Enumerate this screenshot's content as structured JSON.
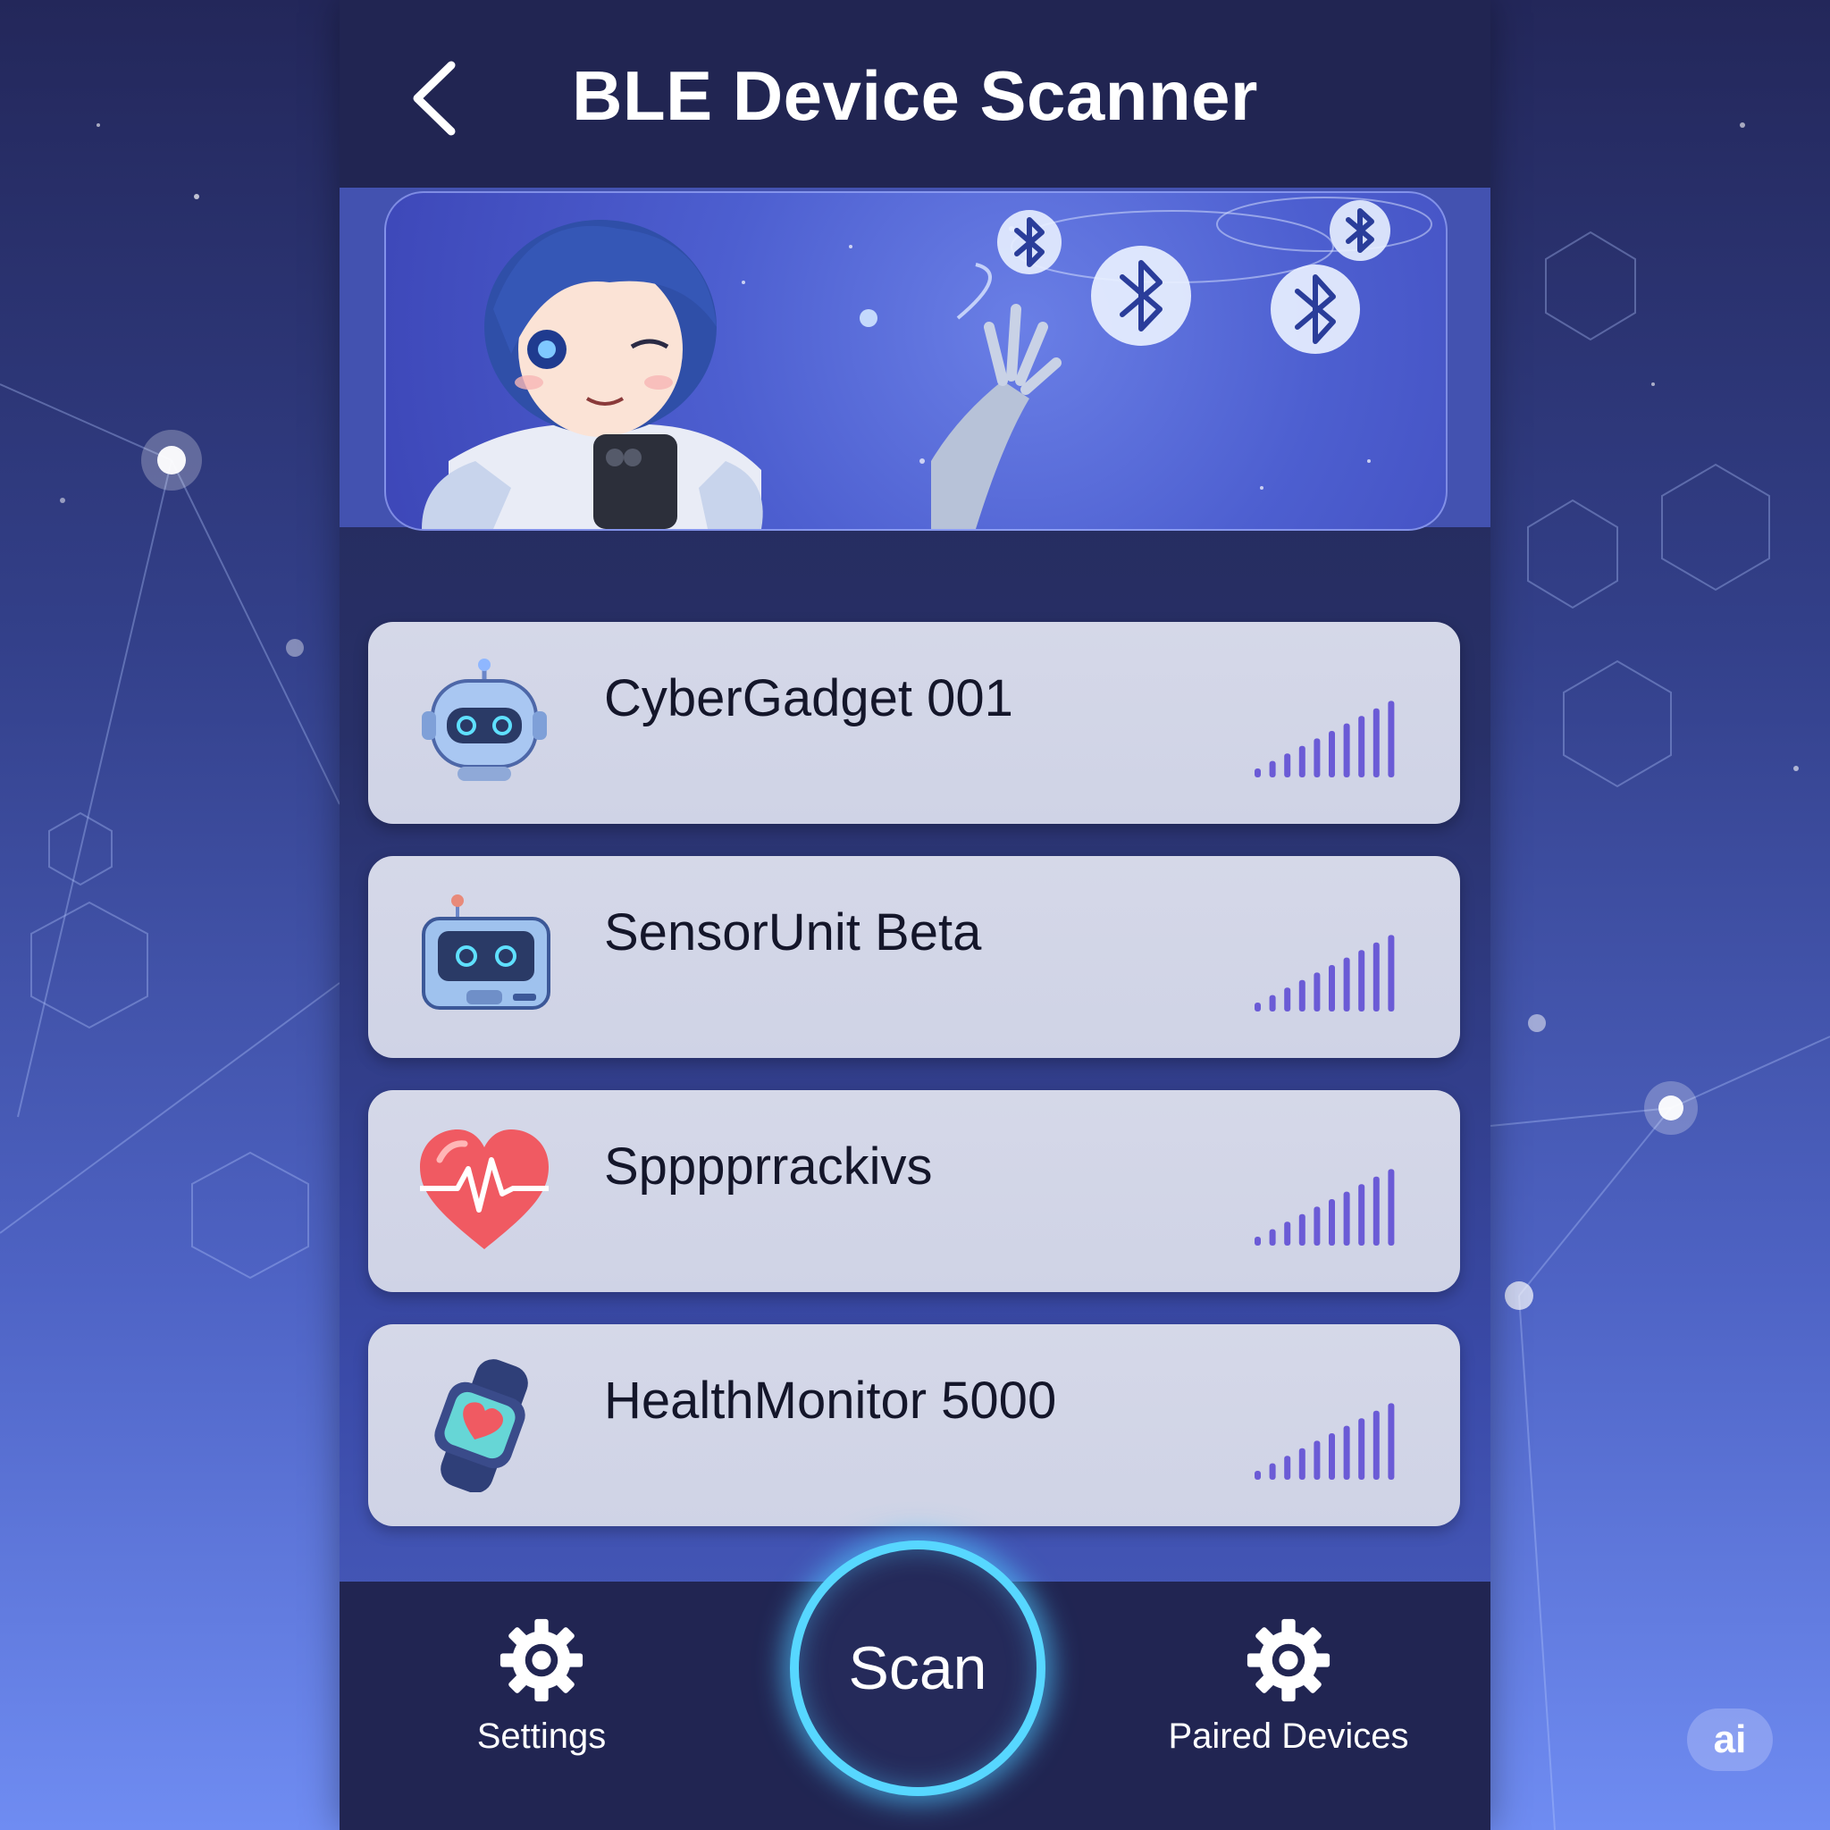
{
  "header": {
    "title": "BLE Device Scanner"
  },
  "banner": {
    "description_icons": [
      "bluetooth-icon"
    ]
  },
  "devices": [
    {
      "name": "CyberGadget 001",
      "icon": "robot-head-icon",
      "signal_bars": 10
    },
    {
      "name": "SensorUnit Beta",
      "icon": "sensor-box-icon",
      "signal_bars": 10
    },
    {
      "name": "Spppprrackivs",
      "icon": "heart-rate-icon",
      "signal_bars": 10
    },
    {
      "name": "HealthMonitor 5000",
      "icon": "smartwatch-icon",
      "signal_bars": 10
    }
  ],
  "bottom_nav": {
    "settings_label": "Settings",
    "scan_label": "Scan",
    "paired_label": "Paired Devices"
  },
  "watermark": "ai",
  "colors": {
    "accent": "#57d7ff",
    "signal": "#6b5bd6",
    "card": "#d3d6e7",
    "bar_bg": "#212552"
  }
}
